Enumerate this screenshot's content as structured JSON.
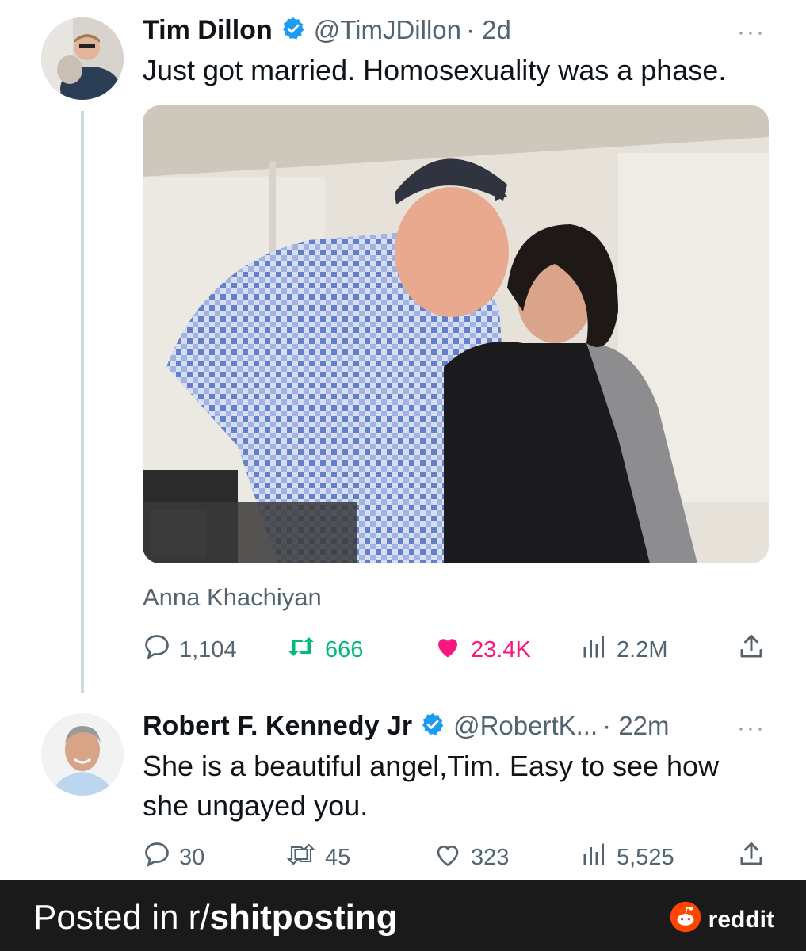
{
  "tweet1": {
    "name": "Tim Dillon",
    "handle": "@TimJDillon",
    "time": "· 2d",
    "text": "Just got married. Homosexuality was a phase.",
    "caption": "Anna Khachiyan",
    "stats": {
      "replies": "1,104",
      "retweets": "666",
      "likes": "23.4K",
      "views": "2.2M"
    },
    "more": "···"
  },
  "tweet2": {
    "name": "Robert F. Kennedy Jr",
    "handle": "@RobertK...",
    "time": "· 22m",
    "text_line1": "She is a beautiful angel,Tim. Easy to see how",
    "text_line2": "she ungayed you.",
    "stats": {
      "replies": "30",
      "retweets": "45",
      "likes": "323",
      "views": "5,525"
    },
    "more": "···"
  },
  "footer": {
    "prefix": "Posted in r/",
    "subreddit": "shitposting",
    "brand": "reddit"
  },
  "colors": {
    "verified": "#1d9bf0",
    "retweet_active": "#00ba7c",
    "like_active": "#f91880",
    "muted": "#536471",
    "footer_bg": "#1a1a1b",
    "reddit_orange": "#ff4500"
  },
  "icons": [
    "verified-badge-icon",
    "reply-icon",
    "retweet-icon",
    "like-icon",
    "views-icon",
    "share-icon",
    "reddit-logo-icon"
  ]
}
